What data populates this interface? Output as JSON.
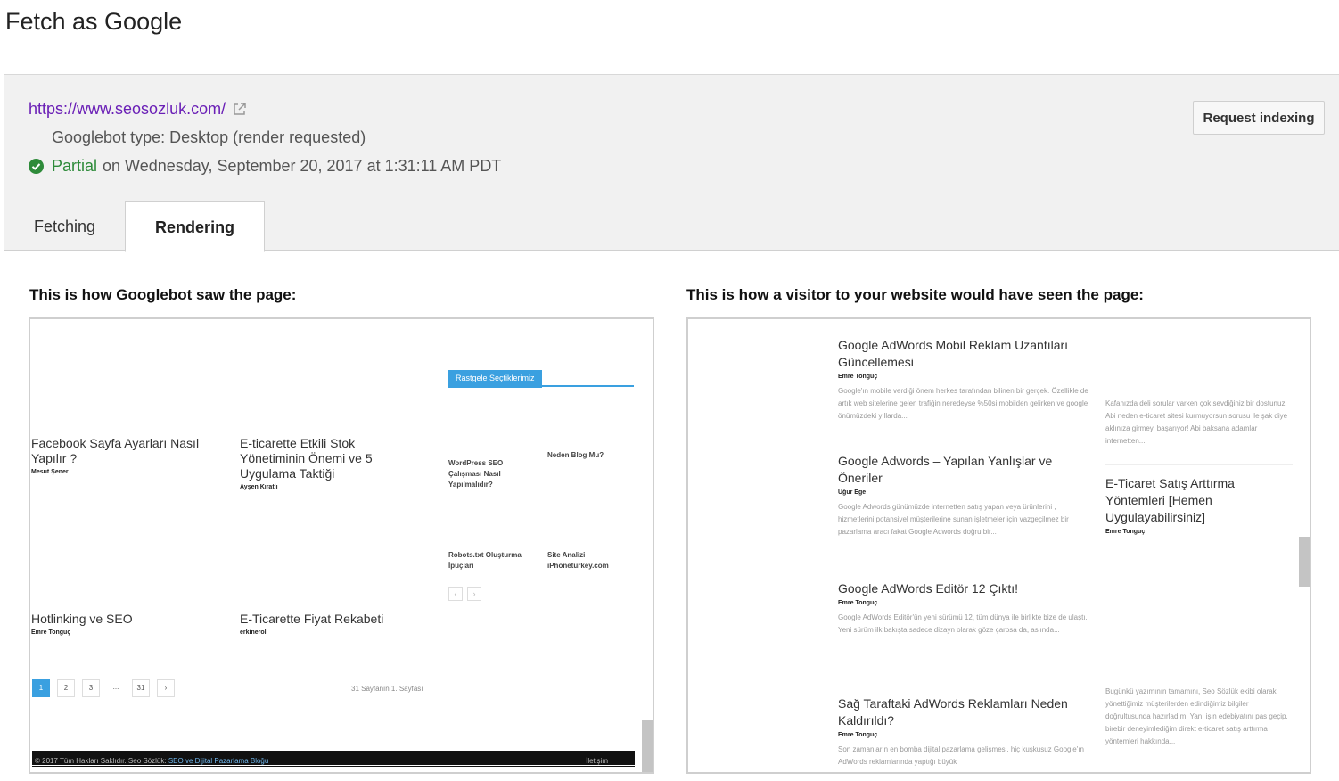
{
  "page_title": "Fetch as Google",
  "summary": {
    "url": "https://www.seosozluk.com/",
    "googlebot_type": "Googlebot type: Desktop (render requested)",
    "status": "Partial",
    "status_detail": "on Wednesday, September 20, 2017 at 1:31:11 AM PDT",
    "request_indexing": "Request indexing"
  },
  "tabs": [
    {
      "label": "Fetching"
    },
    {
      "label": "Rendering"
    }
  ],
  "left_panel": {
    "heading": "This is how Googlebot saw the page:",
    "tag_label": "Rastgele Seçtiklerimiz",
    "articles": [
      {
        "title": "Facebook Sayfa Ayarları Nasıl Yapılır ?",
        "author": "Mesut Şener"
      },
      {
        "title": "E-ticarette Etkili Stok Yönetiminin Önemi ve 5 Uygulama Taktiği",
        "author": "Ayşen Kıratlı"
      },
      {
        "title": "Hotlinking ve SEO",
        "author": "Emre Tonguç"
      },
      {
        "title": "E-Ticarette Fiyat Rekabeti",
        "author": "erkinerol"
      }
    ],
    "side_links": [
      "WordPress SEO Çalışması Nasıl Yapılmalıdır?",
      "Neden Blog Mu?",
      "Robots.txt Oluşturma İpuçları",
      "Site Analizi – iPhoneturkey.com"
    ],
    "nav_prev": "‹",
    "nav_next": "›",
    "pager": [
      "1",
      "2",
      "3",
      "...",
      "31",
      "›"
    ],
    "page_info": "31 Sayfanın 1. Sayfası",
    "footer_text": "© 2017 Tüm Hakları Saklıdır. Seo Sözlük:",
    "footer_link": "SEO ve Dijital Pazarlama Bloğu",
    "footer_right": "İletişim"
  },
  "right_panel": {
    "heading": "This is how a visitor to your website would have seen the page:",
    "articles": [
      {
        "title": "Google AdWords Mobil Reklam Uzantıları Güncellemesi",
        "author": "Emre Tonguç",
        "excerpt": "Google'ın mobile verdiği önem herkes tarafından bilinen bir gerçek. Özellikle de artık web sitelerine gelen trafiğin neredeyse %50si mobilden gelirken ve google önümüzdeki yıllarda..."
      },
      {
        "title": "Google Adwords – Yapılan Yanlışlar ve Öneriler",
        "author": "Uğur Ege",
        "excerpt": "Google Adwords günümüzde internetten satış yapan veya ürünlerini , hizmetlerini potansiyel müşterilerine sunan işletmeler için vazgeçilmez bir pazarlama aracı fakat Google Adwords doğru bir..."
      },
      {
        "title": "Google AdWords Editör 12 Çıktı!",
        "author": "Emre Tonguç",
        "excerpt": "Google AdWords Editör'ün yeni sürümü 12, tüm dünya ile birlikte bize de ulaştı. Yeni sürüm ilk bakışta sadece dizayn olarak göze çarpsa da, aslında..."
      },
      {
        "title": "Sağ Taraftaki AdWords Reklamları Neden Kaldırıldı?",
        "author": "Emre Tonguç",
        "excerpt": "Son zamanların en bomba dijital pazarlama gelişmesi, hiç kuşkusuz Google'ın AdWords reklamlarında yaptığı büyük"
      }
    ],
    "side_excerpt_top": "Kafanızda deli sorular varken çok sevdiğiniz bir dostunuz: Abi neden e-ticaret sitesi kurmuyorsun sorusu ile şak diye aklınıza girmeyi başarıyor! Abi baksana adamlar internetten...",
    "side_article": {
      "title": "E-Ticaret Satış Arttırma Yöntemleri [Hemen Uygulayabilirsiniz]",
      "author": "Emre Tonguç"
    },
    "side_excerpt_bottom": "Bugünkü yazımının tamamını, Seo Sözlük ekibi olarak yönettiğimiz müşterilerden edindiğimiz bilgiler doğrultusunda hazırladım. Yanı işin edebiyatını pas geçip, birebir deneyimlediğim direkt e-ticaret satış arttırma yöntemleri hakkında..."
  },
  "colors": {
    "link": "#6a1fb6",
    "success": "#2e8b3a",
    "accent": "#3aa0e0"
  }
}
